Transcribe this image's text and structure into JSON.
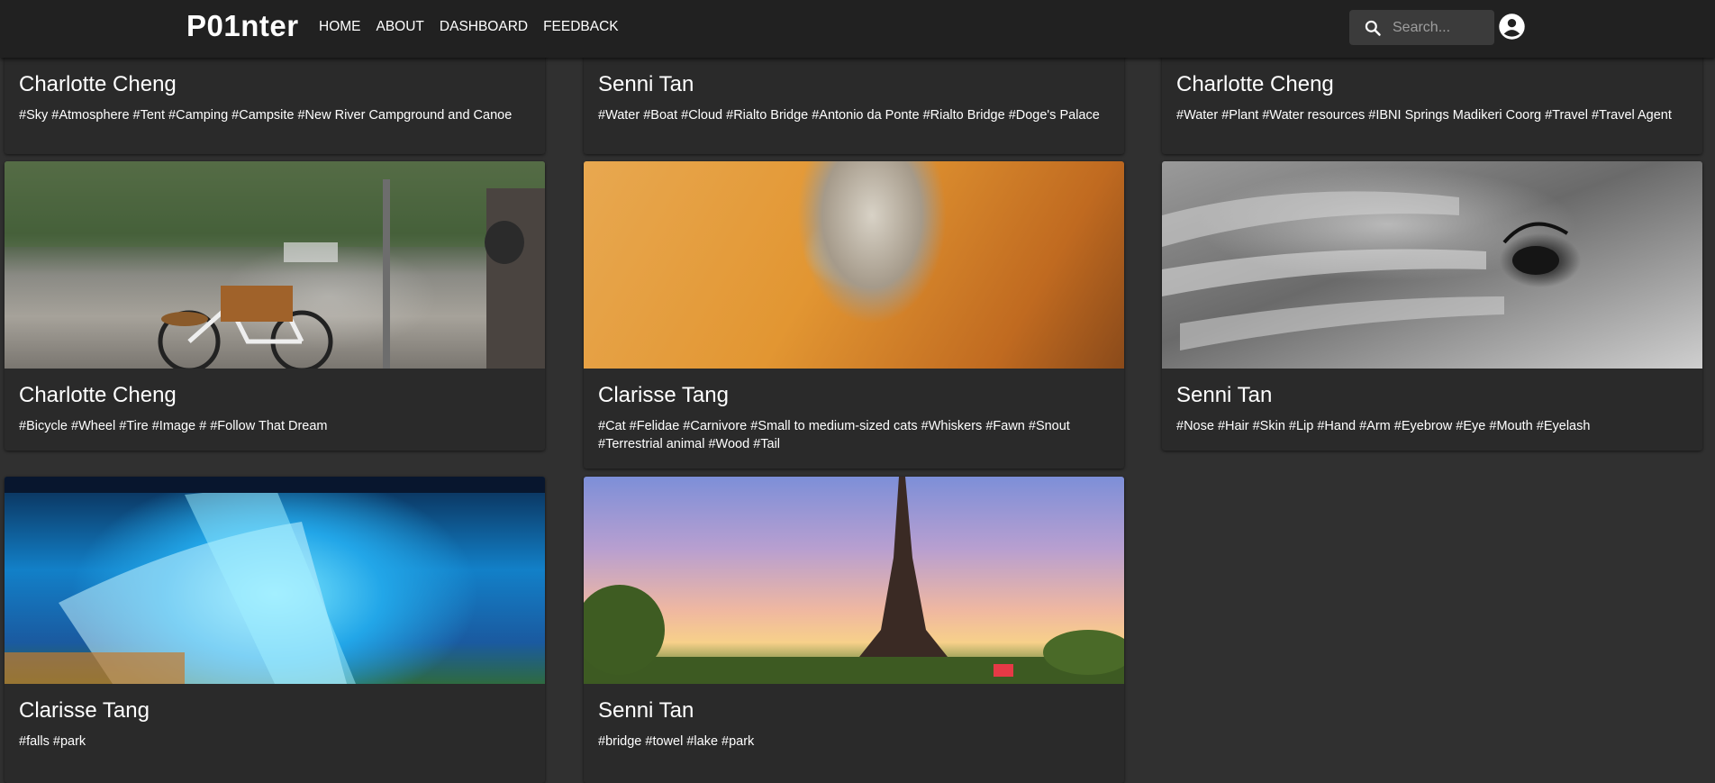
{
  "header": {
    "logo": "P01nter",
    "nav": [
      "HOME",
      "ABOUT",
      "DASHBOARD",
      "FEEDBACK"
    ],
    "search_placeholder": "Search..."
  },
  "cards": [
    {
      "author": "Charlotte Cheng",
      "tags": "#Sky #Atmosphere #Tent #Camping #Campsite #New River Campground and Canoe"
    },
    {
      "author": "Senni Tan",
      "tags": "#Water #Boat #Cloud #Rialto Bridge #Antonio da Ponte #Rialto Bridge #Doge's Palace"
    },
    {
      "author": "Charlotte Cheng",
      "tags": "#Water #Plant #Water resources #IBNI Springs Madikeri Coorg #Travel #Travel Agent"
    },
    {
      "author": "Charlotte Cheng",
      "tags": "#Bicycle #Wheel #Tire #Image # #Follow That Dream"
    },
    {
      "author": "Clarisse Tang",
      "tags": "#Cat #Felidae #Carnivore #Small to medium-sized cats #Whiskers #Fawn #Snout #Terrestrial animal #Wood #Tail"
    },
    {
      "author": "Senni Tan",
      "tags": "#Nose #Hair #Skin #Lip #Hand #Arm #Eyebrow #Eye #Mouth #Eyelash"
    },
    {
      "author": "Clarisse Tang",
      "tags": "#falls #park"
    },
    {
      "author": "Senni Tan",
      "tags": "#bridge #towel #lake #park"
    }
  ]
}
